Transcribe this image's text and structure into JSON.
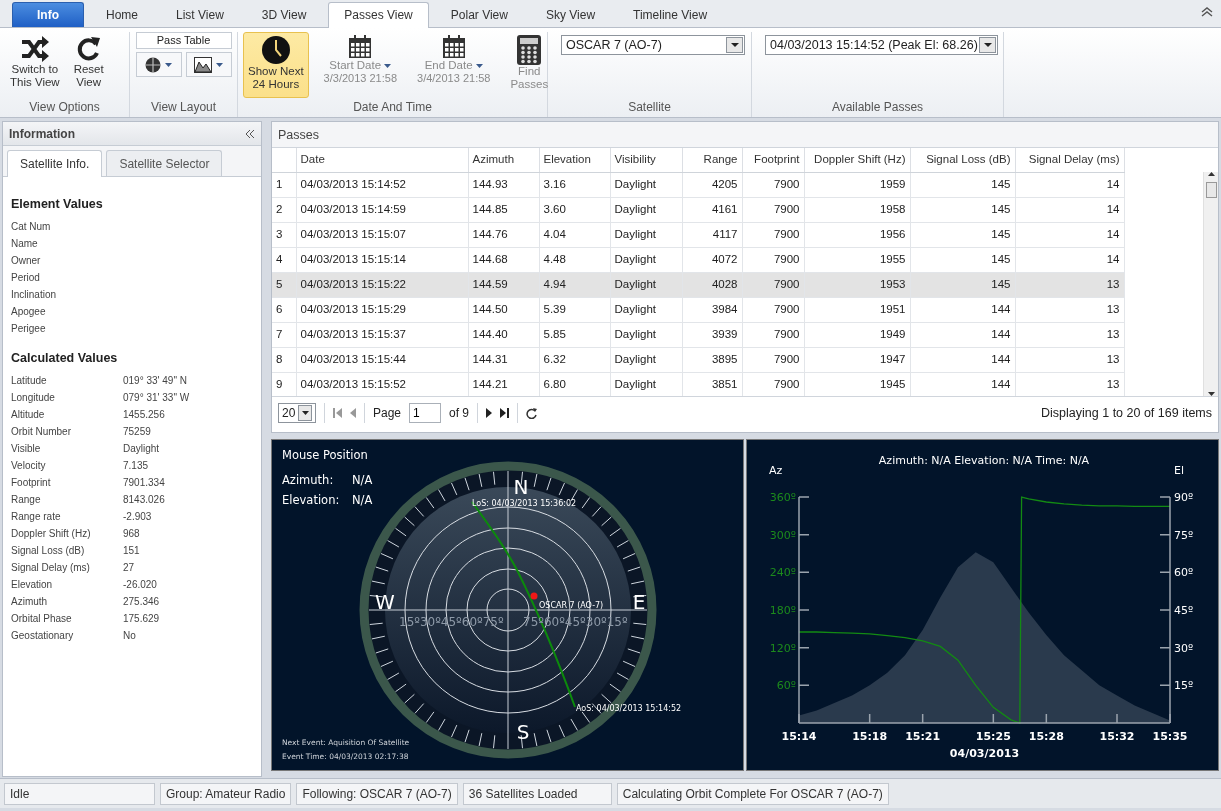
{
  "tabs": [
    {
      "label": "Info",
      "kind": "app",
      "selected": false
    },
    {
      "label": "Home",
      "kind": "tab",
      "selected": false
    },
    {
      "label": "List View",
      "kind": "tab",
      "selected": false
    },
    {
      "label": "3D View",
      "kind": "tab",
      "selected": false
    },
    {
      "label": "Passes View",
      "kind": "tab",
      "selected": true
    },
    {
      "label": "Polar View",
      "kind": "tab",
      "selected": false
    },
    {
      "label": "Sky View",
      "kind": "tab",
      "selected": false
    },
    {
      "label": "Timeline View",
      "kind": "tab",
      "selected": false
    }
  ],
  "ribbon": {
    "view_options": {
      "label": "View Options",
      "switch_button": [
        "Switch to",
        "This View"
      ],
      "reset_button": [
        "Reset",
        "View"
      ]
    },
    "view_layout": {
      "label": "View Layout",
      "pass_table": "Pass Table"
    },
    "date_and_time": {
      "label": "Date And Time",
      "show_next": {
        "lines": [
          "Show Next",
          "24 Hours"
        ],
        "selected": true
      },
      "start_date": {
        "label": "Start Date",
        "value": "3/3/2013 21:58",
        "disabled": true
      },
      "end_date": {
        "label": "End Date",
        "value": "3/4/2013 21:58",
        "disabled": true
      },
      "find_passes": {
        "lines": [
          "Find",
          "Passes"
        ],
        "disabled": true
      }
    },
    "satellite": {
      "label": "Satellite",
      "value": "OSCAR 7 (AO-7)"
    },
    "available_passes": {
      "label": "Available Passes",
      "value": "04/03/2013 15:14:52 (Peak El: 68.26)"
    }
  },
  "information": {
    "title": "Information",
    "tabs": [
      {
        "label": "Satellite Info.",
        "selected": true
      },
      {
        "label": "Satellite Selector",
        "selected": false
      }
    ],
    "element_values": {
      "title": "Element Values",
      "items": [
        "Cat Num",
        "Name",
        "Owner",
        "Period",
        "Inclination",
        "Apogee",
        "Perigee"
      ]
    },
    "calculated_values": {
      "title": "Calculated Values",
      "items": [
        {
          "label": "Latitude",
          "value": "019° 33' 49\" N"
        },
        {
          "label": "Longitude",
          "value": "079° 31' 33\" W"
        },
        {
          "label": "Altitude",
          "value": "1455.256"
        },
        {
          "label": "Orbit Number",
          "value": "75259"
        },
        {
          "label": "Visible",
          "value": "Daylight"
        },
        {
          "label": "Velocity",
          "value": "7.135"
        },
        {
          "label": "Footprint",
          "value": "7901.334"
        },
        {
          "label": "Range",
          "value": "8143.026"
        },
        {
          "label": "Range rate",
          "value": "-2.903"
        },
        {
          "label": "Doppler Shift (Hz)",
          "value": "968"
        },
        {
          "label": "Signal Loss (dB)",
          "value": "151"
        },
        {
          "label": "Signal Delay (ms)",
          "value": "27"
        },
        {
          "label": "Elevation",
          "value": "-26.020"
        },
        {
          "label": "Azimuth",
          "value": "275.346"
        },
        {
          "label": "Orbital Phase",
          "value": "175.629"
        },
        {
          "label": "Geostationary",
          "value": "No"
        }
      ]
    }
  },
  "passes": {
    "title": "Passes",
    "columns": [
      {
        "label": "Date",
        "numeric": false
      },
      {
        "label": "Azimuth",
        "numeric": false
      },
      {
        "label": "Elevation",
        "numeric": false
      },
      {
        "label": "Visibility",
        "numeric": false
      },
      {
        "label": "Range",
        "numeric": true
      },
      {
        "label": "Footprint",
        "numeric": true
      },
      {
        "label": "Doppler Shift (Hz)",
        "numeric": true
      },
      {
        "label": "Signal Loss (dB)",
        "numeric": true
      },
      {
        "label": "Signal Delay (ms)",
        "numeric": true
      }
    ],
    "rows": [
      {
        "number": "1",
        "selected": false,
        "cells": [
          "04/03/2013 15:14:52",
          "144.93",
          "3.16",
          "Daylight",
          "4205",
          "7900",
          "1959",
          "145",
          "14"
        ]
      },
      {
        "number": "2",
        "selected": false,
        "cells": [
          "04/03/2013 15:14:59",
          "144.85",
          "3.60",
          "Daylight",
          "4161",
          "7900",
          "1958",
          "145",
          "14"
        ]
      },
      {
        "number": "3",
        "selected": false,
        "cells": [
          "04/03/2013 15:15:07",
          "144.76",
          "4.04",
          "Daylight",
          "4117",
          "7900",
          "1956",
          "145",
          "14"
        ]
      },
      {
        "number": "4",
        "selected": false,
        "cells": [
          "04/03/2013 15:15:14",
          "144.68",
          "4.48",
          "Daylight",
          "4072",
          "7900",
          "1955",
          "145",
          "14"
        ]
      },
      {
        "number": "5",
        "selected": true,
        "cells": [
          "04/03/2013 15:15:22",
          "144.59",
          "4.94",
          "Daylight",
          "4028",
          "7900",
          "1953",
          "145",
          "13"
        ]
      },
      {
        "number": "6",
        "selected": false,
        "cells": [
          "04/03/2013 15:15:29",
          "144.50",
          "5.39",
          "Daylight",
          "3984",
          "7900",
          "1951",
          "144",
          "13"
        ]
      },
      {
        "number": "7",
        "selected": false,
        "cells": [
          "04/03/2013 15:15:37",
          "144.40",
          "5.85",
          "Daylight",
          "3939",
          "7900",
          "1949",
          "144",
          "13"
        ]
      },
      {
        "number": "8",
        "selected": false,
        "cells": [
          "04/03/2013 15:15:44",
          "144.31",
          "6.32",
          "Daylight",
          "3895",
          "7900",
          "1947",
          "144",
          "13"
        ]
      },
      {
        "number": "9",
        "selected": false,
        "cells": [
          "04/03/2013 15:15:52",
          "144.21",
          "6.80",
          "Daylight",
          "3851",
          "7900",
          "1945",
          "144",
          "13"
        ]
      }
    ],
    "pager": {
      "page_size": "20",
      "page_label": "Page",
      "page": "1",
      "page_count": "of 9",
      "summary": "Displaying 1 to 20 of 169 items"
    }
  },
  "polar": {
    "title": "Mouse Position",
    "azimuth_label": "Azimuth:",
    "azimuth_value": "N/A",
    "elevation_label": "Elevation:",
    "elevation_value": "N/A",
    "compass": [
      "N",
      "E",
      "S",
      "W"
    ],
    "ring_labels_west": "15º30º45º60º75º",
    "ring_labels_east": "75º60º45º30º15º",
    "los_label": "LoS: 04/03/2013 15:36:02",
    "aos_label": "AoS: 04/03/2013 15:14:52",
    "satellite_label": "OSCAR 7 (AO-7)",
    "next_event": "Next Event: Aquisition Of Satellite",
    "event_time": "Event Time: 04/03/2013 02:17:38"
  },
  "timeline": {
    "title": "Azimuth: N/A Elevation: N/A Time: N/A",
    "chart_data": {
      "type": "line",
      "xlabel": "04/03/2013",
      "ylabel": "Az",
      "y2label": "El",
      "x": [
        914,
        915,
        916,
        917,
        918,
        919,
        920,
        921,
        922,
        923,
        924,
        925,
        926,
        926.5,
        926.6,
        927,
        928,
        929,
        930,
        931,
        932,
        933,
        934,
        935
      ],
      "xlim": [
        914,
        935
      ],
      "xticks": [
        {
          "value": 914,
          "label": "15:14"
        },
        {
          "value": 918,
          "label": "15:18"
        },
        {
          "value": 921,
          "label": "15:21"
        },
        {
          "value": 925,
          "label": "15:25"
        },
        {
          "value": 928,
          "label": "15:28"
        },
        {
          "value": 932,
          "label": "15:32"
        },
        {
          "value": 935,
          "label": "15:35"
        }
      ],
      "ylim": [
        0,
        360
      ],
      "yticks": [
        {
          "value": 60,
          "label": "60º"
        },
        {
          "value": 120,
          "label": "120º"
        },
        {
          "value": 180,
          "label": "180º"
        },
        {
          "value": 240,
          "label": "240º"
        },
        {
          "value": 300,
          "label": "300º"
        },
        {
          "value": 360,
          "label": "360º"
        }
      ],
      "y2lim": [
        0,
        90
      ],
      "y2ticks": [
        {
          "value": 15,
          "label": "15º"
        },
        {
          "value": 30,
          "label": "30º"
        },
        {
          "value": 45,
          "label": "45º"
        },
        {
          "value": 60,
          "label": "60º"
        },
        {
          "value": 75,
          "label": "75º"
        },
        {
          "value": 90,
          "label": "90º"
        }
      ],
      "series": [
        {
          "color": "#2a3a4d",
          "type": "area",
          "axis": "y2",
          "values": [
            3,
            5,
            8,
            11,
            15,
            20,
            27,
            37,
            50,
            62,
            68,
            64,
            54,
            49,
            48,
            44,
            35,
            27,
            21,
            15,
            11,
            7,
            4,
            1
          ]
        },
        {
          "color": "#138a13",
          "values": [
            145,
            145,
            144,
            143,
            142,
            139,
            136,
            131,
            122,
            100,
            60,
            25,
            5,
            0,
            360,
            357,
            352,
            349,
            347,
            346,
            346,
            345,
            345,
            345
          ]
        }
      ]
    }
  },
  "status_bar": [
    "Idle",
    "Group: Amateur Radio",
    "Following: OSCAR 7 (AO-7)",
    "36 Satellites Loaded",
    "Calculating Orbit Complete For OSCAR 7 (AO-7)"
  ]
}
